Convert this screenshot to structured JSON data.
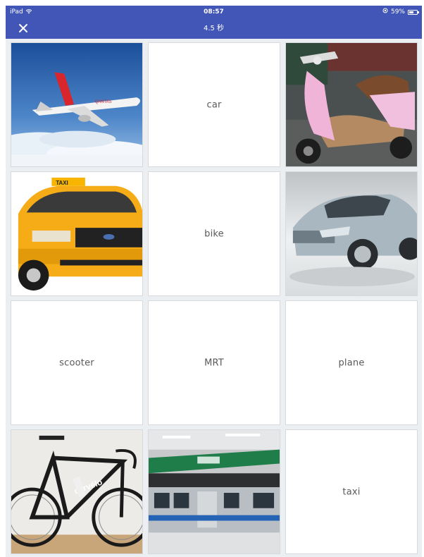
{
  "status_bar": {
    "device": "iPad",
    "time": "08:57",
    "battery": "59%"
  },
  "header": {
    "timer": "4.5 秒"
  },
  "cards": {
    "car_label": "car",
    "bike_label": "bike",
    "scooter_label": "scooter",
    "mrt_label": "MRT",
    "plane_label": "plane",
    "taxi_label": "taxi"
  },
  "colors": {
    "header_bg": "#4256b7",
    "grid_bg": "#eceff1"
  },
  "icons": [
    "wifi-icon",
    "close-icon",
    "location-icon",
    "battery-icon"
  ]
}
